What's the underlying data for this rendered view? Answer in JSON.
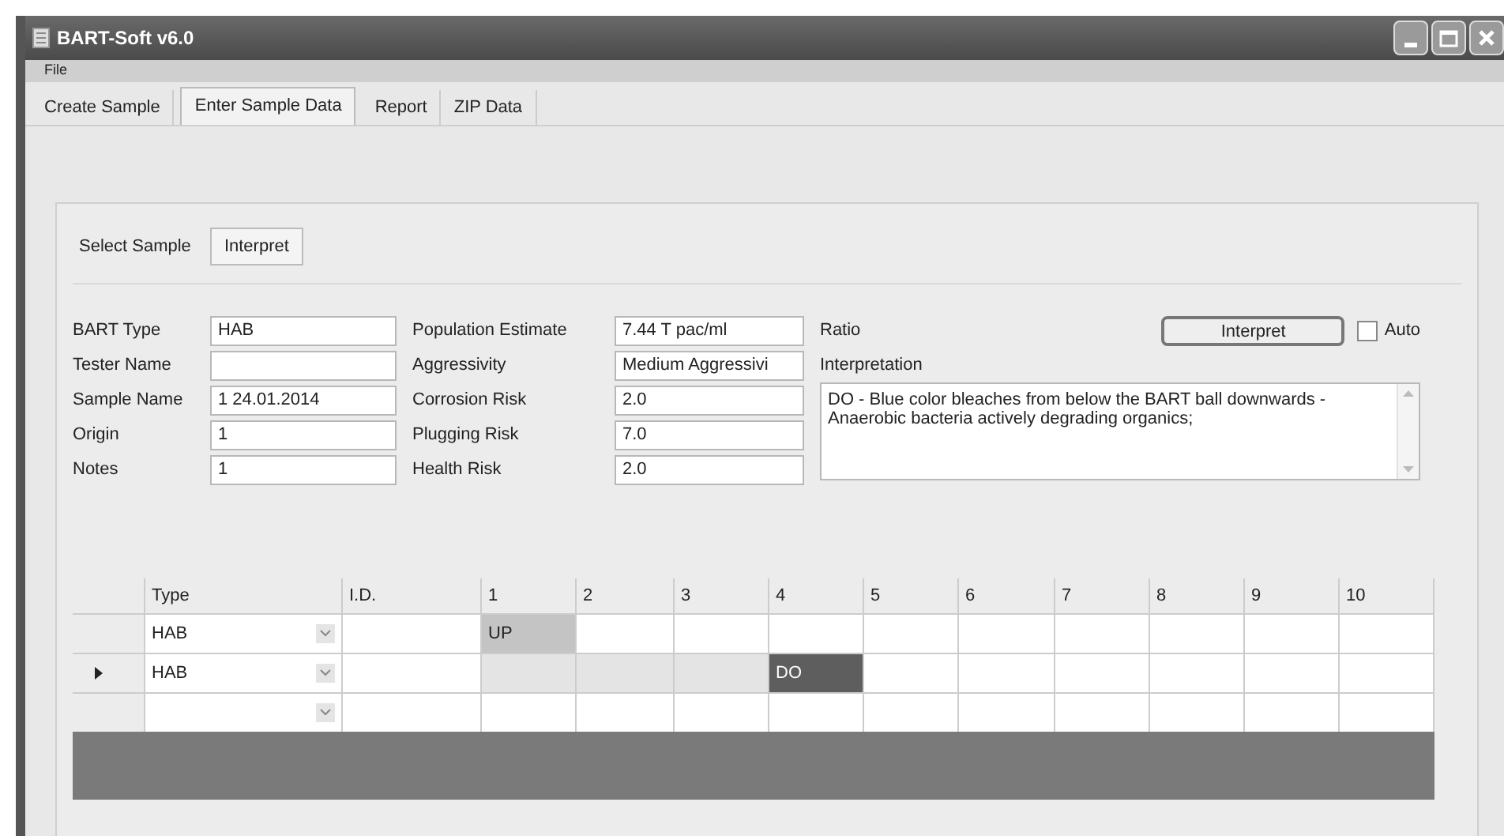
{
  "window": {
    "title": "BART-Soft v6.0"
  },
  "menu": [
    "File"
  ],
  "tabs": [
    {
      "label": "Create Sample",
      "selected": false
    },
    {
      "label": "Enter Sample Data",
      "selected": true
    },
    {
      "label": "Report",
      "selected": false
    },
    {
      "label": "ZIP Data",
      "selected": false
    }
  ],
  "subtabs": [
    {
      "label": "Select Sample",
      "selected": false
    },
    {
      "label": "Interpret",
      "selected": true
    }
  ],
  "fields_left": [
    {
      "label": "BART Type",
      "value": "HAB"
    },
    {
      "label": "Tester Name"
    },
    {
      "label": "Sample Name",
      "value": "1 24.01.2014"
    },
    {
      "label": "Origin",
      "value": "1"
    },
    {
      "label": "Notes",
      "value": "1"
    }
  ],
  "fields_right": [
    {
      "label": "Population Estimate",
      "value": "7.44 T pac/ml"
    },
    {
      "label": "Aggressivity",
      "value": "Medium Aggressivi"
    },
    {
      "label": "Corrosion Risk",
      "value": "2.0"
    },
    {
      "label": "Plugging Risk",
      "value": "7.0"
    },
    {
      "label": "Health Risk",
      "value": "2.0"
    }
  ],
  "ratio_label": "Ratio",
  "interpret_button": "Interpret",
  "auto": {
    "label": "Auto",
    "checked": false
  },
  "interpretation": {
    "label": "Interpretation",
    "text": "DO - Blue color bleaches from below the BART ball downwards - Anaerobic bacteria actively degrading organics;"
  },
  "grid": {
    "columns": [
      "Type",
      "I.D.",
      "1",
      "2",
      "3",
      "4",
      "5",
      "6",
      "7",
      "8",
      "9",
      "10"
    ],
    "rows": [
      {
        "selected": false,
        "cells": [
          {
            "text": "HAB"
          },
          {
            "text": ""
          },
          {
            "text": "UP",
            "color": "#c4c4c4"
          },
          {
            "text": ""
          },
          {
            "text": ""
          },
          {
            "text": ""
          },
          {
            "text": ""
          },
          {
            "text": ""
          },
          {
            "text": ""
          },
          {
            "text": ""
          },
          {
            "text": ""
          },
          {
            "text": ""
          }
        ]
      },
      {
        "selected": true,
        "cells": [
          {
            "text": "HAB"
          },
          {
            "text": ""
          },
          {
            "text": "",
            "color": "#e4e4e4"
          },
          {
            "text": "",
            "color": "#e4e4e4"
          },
          {
            "text": "",
            "color": "#e4e4e4"
          },
          {
            "text": "DO",
            "color": "#5e5e5e"
          },
          {
            "text": ""
          },
          {
            "text": ""
          },
          {
            "text": ""
          },
          {
            "text": ""
          },
          {
            "text": ""
          },
          {
            "text": ""
          }
        ]
      },
      {
        "selected": false,
        "cells": [
          {
            "text": ""
          },
          {
            "text": ""
          },
          {
            "text": ""
          },
          {
            "text": ""
          },
          {
            "text": ""
          },
          {
            "text": ""
          },
          {
            "text": ""
          },
          {
            "text": ""
          },
          {
            "text": ""
          },
          {
            "text": ""
          },
          {
            "text": ""
          },
          {
            "text": ""
          }
        ]
      }
    ]
  }
}
